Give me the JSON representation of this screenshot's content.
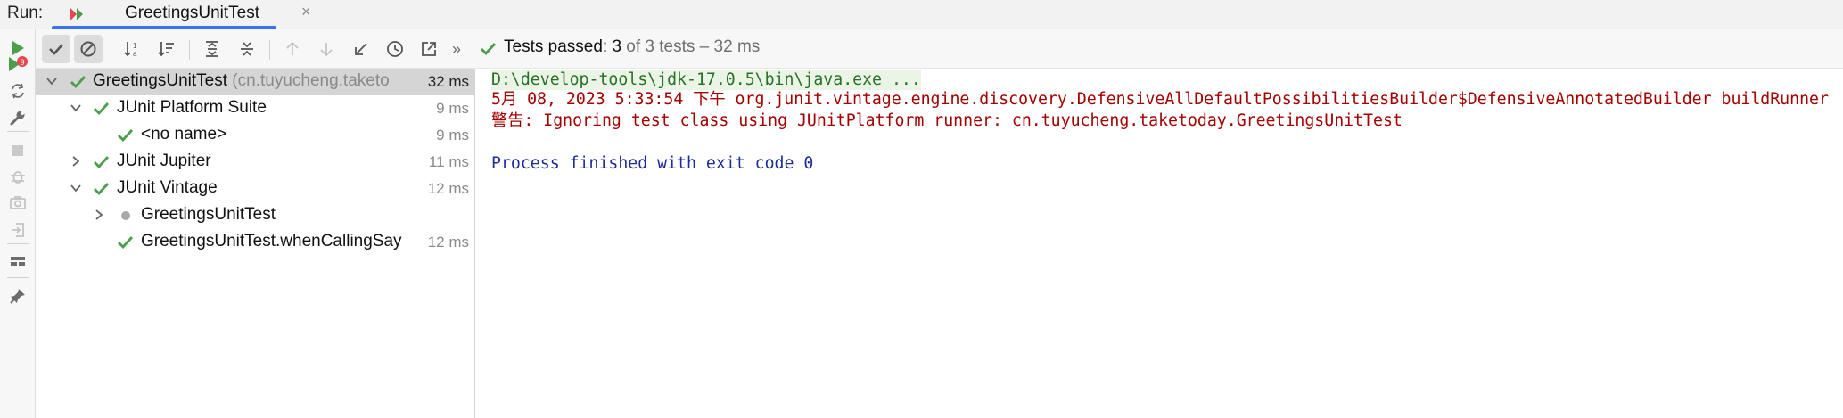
{
  "run_bar": {
    "run_label": "Run:",
    "tab_title": "GreetingsUnitTest",
    "close_glyph": "×"
  },
  "toolbar": {
    "status_main": "Tests passed: 3",
    "status_sub": " of 3 tests – 32 ms",
    "more_glyph": "»"
  },
  "tree": {
    "rows": [
      {
        "label": "GreetingsUnitTest",
        "hint": " (cn.tuyucheng.taketo",
        "time": "32 ms",
        "status": "passed",
        "expanded": true
      },
      {
        "label": "JUnit Platform Suite",
        "hint": "",
        "time": "9 ms",
        "status": "passed",
        "expanded": true
      },
      {
        "label": "<no name>",
        "hint": "",
        "time": "9 ms",
        "status": "passed",
        "expanded": null
      },
      {
        "label": "JUnit Jupiter",
        "hint": "",
        "time": "11 ms",
        "status": "passed",
        "expanded": false
      },
      {
        "label": "JUnit Vintage",
        "hint": "",
        "time": "12 ms",
        "status": "passed",
        "expanded": true
      },
      {
        "label": "GreetingsUnitTest",
        "hint": "",
        "time": "",
        "status": "ignored",
        "expanded": false
      },
      {
        "label": "GreetingsUnitTest.whenCallingSay",
        "hint": "",
        "time": "12 ms",
        "status": "passed",
        "expanded": null
      }
    ]
  },
  "console": {
    "lines": [
      "D:\\develop-tools\\jdk-17.0.5\\bin\\java.exe ...",
      "5月 08, 2023 5:33:54 下午 org.junit.vintage.engine.discovery.DefensiveAllDefaultPossibilitiesBuilder$DefensiveAnnotatedBuilder buildRunner",
      "警告: Ignoring test class using JUnitPlatform runner: cn.tuyucheng.taketoday.GreetingsUnitTest",
      "Process finished with exit code 0"
    ]
  },
  "colors": {
    "accent": "#3574f0",
    "passed": "#4a9f4a",
    "error_text": "#a40000",
    "exit_text": "#1d2b9a",
    "command_text": "#2a6f2a"
  },
  "icons": {
    "vertical_toolbar": [
      "rerun-icon",
      "rerun-failed-icon",
      "toggle-auto-test-icon",
      "settings-wrench-icon",
      "stop-icon",
      "debug-disabled-icon",
      "screenshot-icon",
      "exit-icon",
      "layout-icon",
      "pin-icon"
    ],
    "horizontal_toolbar": [
      "show-passed-icon",
      "show-ignored-icon",
      "sort-alphabetically-icon",
      "sort-by-duration-icon",
      "expand-all-icon",
      "collapse-all-icon",
      "previous-failed-icon",
      "next-failed-icon",
      "import-tests-icon",
      "history-icon",
      "export-tests-icon"
    ]
  }
}
